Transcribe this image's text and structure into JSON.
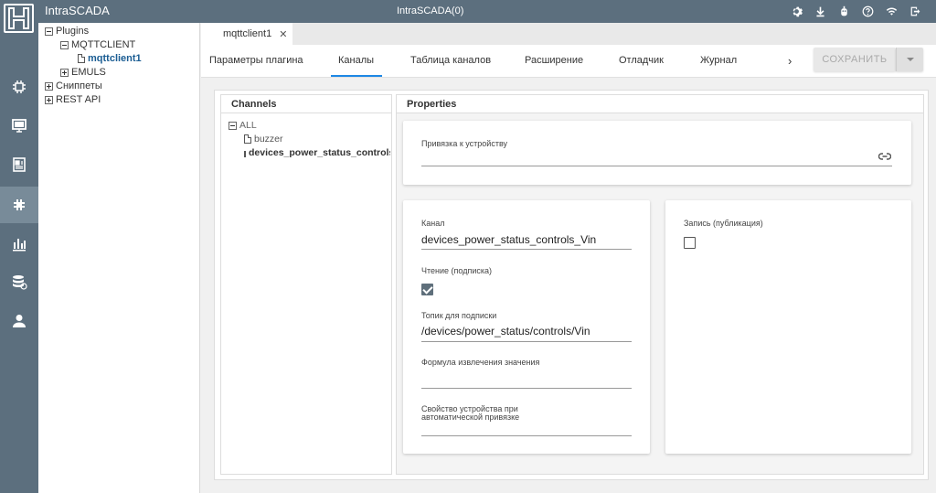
{
  "app": {
    "title": "IntraSCADA",
    "window_title": "IntraSCADA(0)"
  },
  "topbar_icons": [
    "gear-icon",
    "download-icon",
    "robot-icon",
    "help-icon",
    "wifi-icon",
    "logout-icon"
  ],
  "rail_icons": [
    "chip-icon",
    "monitor-icon",
    "document-icon",
    "plugin-icon",
    "chart-icon",
    "database-icon",
    "user-icon"
  ],
  "tree": {
    "plugins": "Plugins",
    "mqttclient": "MQTTCLIENT",
    "mqttclient1": "mqttclient1",
    "emuls": "EMULS",
    "snippets": "Сниппеты",
    "rest_api": "REST API"
  },
  "doc_tab": {
    "label": "mqttclient1",
    "close": "✕"
  },
  "tabs": [
    "Параметры плагина",
    "Каналы",
    "Таблица каналов",
    "Расширение",
    "Отладчик",
    "Журнал"
  ],
  "active_tab": "Каналы",
  "tabs_more": "›",
  "save_button": "СОХРАНИТЬ",
  "channels": {
    "header": "Channels",
    "root": "ALL",
    "items": [
      "buzzer",
      "devices_power_status_controls_Vin"
    ]
  },
  "properties": {
    "header": "Properties",
    "device_binding_label": "Привязка к устройству",
    "device_binding_value": "",
    "channel_label": "Канал",
    "channel_value": "devices_power_status_controls_Vin",
    "read_label": "Чтение (подписка)",
    "read_checked": true,
    "sub_topic_label": "Топик для подписки",
    "sub_topic_value": "/devices/power_status/controls/Vin",
    "formula_label": "Формула извлечения значения",
    "formula_value": "",
    "device_prop_label_line1": "Свойство устройства при",
    "device_prop_label_line2": "автоматической привязке",
    "device_prop_value": "",
    "write_label": "Запись (публикация)",
    "write_checked": false
  }
}
